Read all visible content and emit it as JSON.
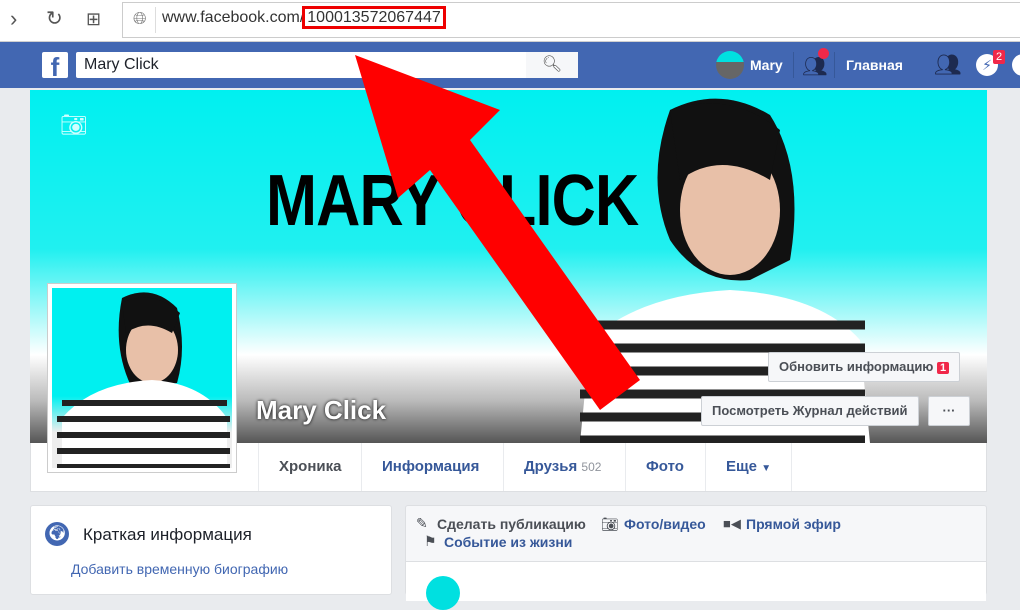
{
  "browser": {
    "url_domain": "www.facebook.com/",
    "url_id": "100013572067447"
  },
  "header": {
    "search_value": "Mary Click",
    "user_name": "Mary",
    "home_label": "Главная",
    "messages_badge": "2",
    "brand_color": "#4267b2"
  },
  "cover": {
    "title": "MARY CLICK",
    "name": "Mary Click",
    "update_info": "Обновить информацию",
    "update_badge": "1",
    "activity_log": "Посмотреть Журнал действий",
    "more": "···"
  },
  "tabs": [
    {
      "label": "Хроника"
    },
    {
      "label": "Информация"
    },
    {
      "label": "Друзья",
      "count": "502"
    },
    {
      "label": "Фото"
    },
    {
      "label": "Еще"
    }
  ],
  "intro": {
    "title": "Краткая информация",
    "link": "Добавить временную биографию"
  },
  "composer": {
    "post": "Сделать публикацию",
    "photo": "Фото/видео",
    "live": "Прямой эфир",
    "life_event": "Событие из жизни"
  }
}
